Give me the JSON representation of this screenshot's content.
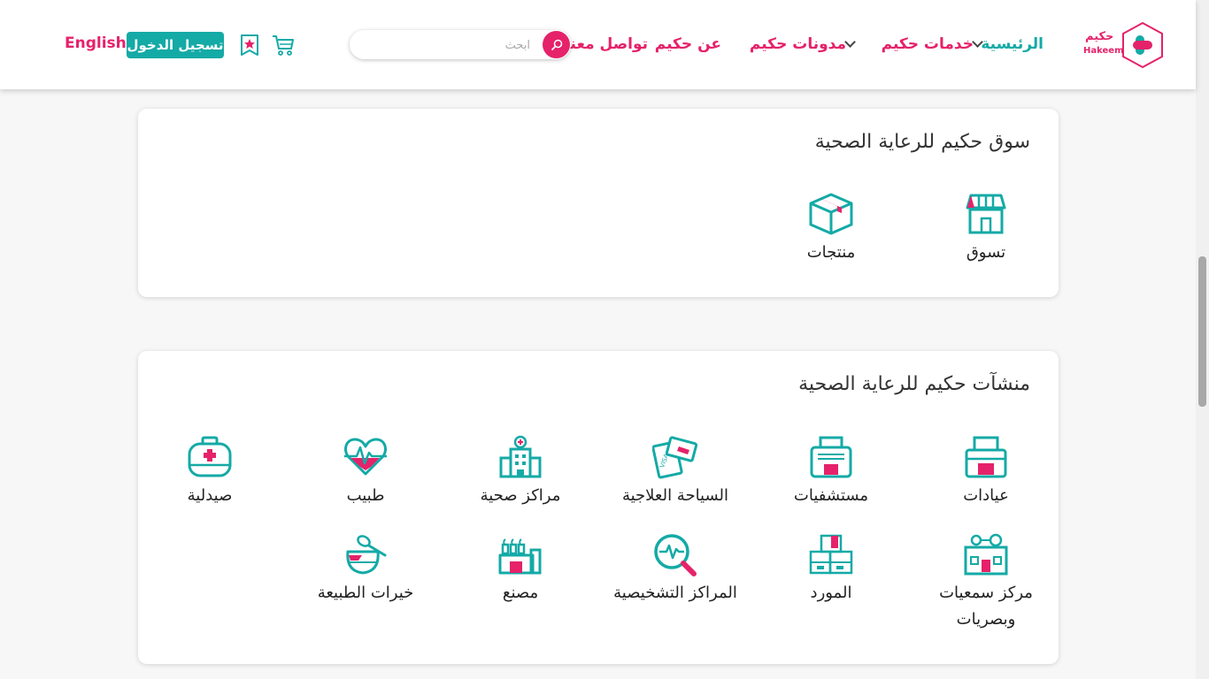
{
  "header": {
    "logo_ar": "حكيم",
    "logo_en": "Hakeem",
    "nav": {
      "home": "الرئيسية",
      "services": "خدمات حكيم",
      "blogs": "مدونات حكيم",
      "about": "عن حكيم",
      "contact": "تواصل معنا"
    },
    "search_placeholder": "ابحث",
    "login": "تسجيل الدخول",
    "language": "English"
  },
  "market": {
    "title": "سوق حكيم للرعاية الصحية",
    "items": [
      {
        "label": "تسوق",
        "icon": "store-icon"
      },
      {
        "label": "منتجات",
        "icon": "box-icon"
      }
    ]
  },
  "facilities": {
    "title": "منشآت حكيم للرعاية الصحية",
    "items": [
      {
        "label": "عيادات",
        "icon": "clinic-icon"
      },
      {
        "label": "مستشفيات",
        "icon": "hospital-icon"
      },
      {
        "label": "السياحة العلاجية",
        "icon": "passport-icon"
      },
      {
        "label": "مراكز صحية",
        "icon": "health-center-icon"
      },
      {
        "label": "طبيب",
        "icon": "heartbeat-icon"
      },
      {
        "label": "صيدلية",
        "icon": "first-aid-kit-icon"
      },
      {
        "label": "مركز سمعيات وبصريات",
        "icon": "glasses-icon"
      },
      {
        "label": "المورد",
        "icon": "boxes-icon"
      },
      {
        "label": "المراكز التشخيصية",
        "icon": "diagnostic-magnifier-icon"
      },
      {
        "label": "مصنع",
        "icon": "factory-icon"
      },
      {
        "label": "خيرات الطبيعة",
        "icon": "honey-icon"
      }
    ]
  },
  "colors": {
    "teal": "#14aaa6",
    "pink": "#e5226a"
  }
}
